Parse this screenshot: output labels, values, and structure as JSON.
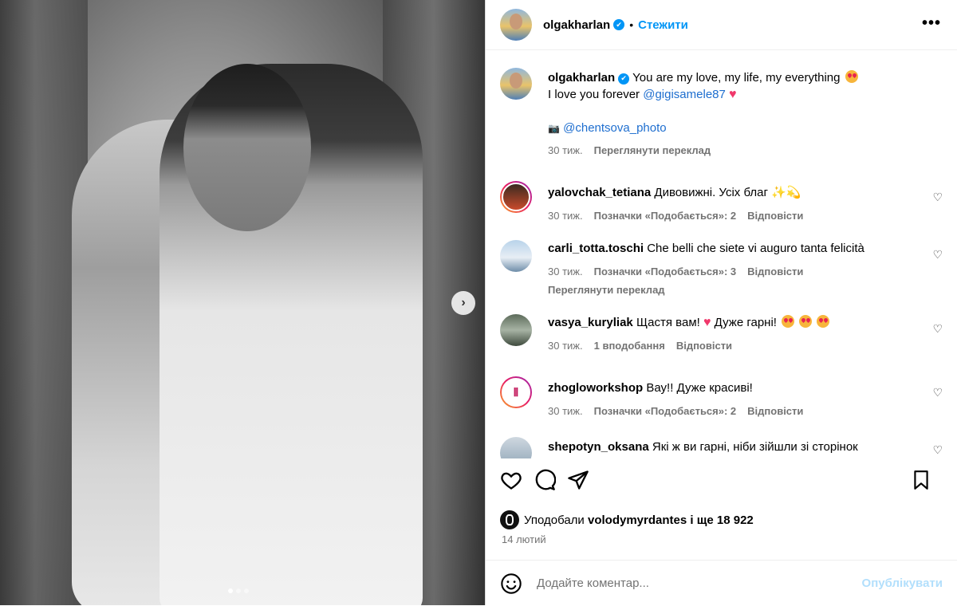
{
  "post": {
    "owner": "olgakharlan",
    "follow_label": "Стежити",
    "separator": "•",
    "more_label": "•••",
    "caption_line1": "You are my love, my life, my everything",
    "caption_line2_prefix": "I love you forever",
    "caption_mention": "@gigisamele87",
    "photo_credit_icon": "📷",
    "photo_credit": "@chentsova_photo",
    "caption_time": "30 тиж.",
    "translate_label": "Переглянути переклад"
  },
  "comments": [
    {
      "user": "yalovchak_tetiana",
      "text": "Дивовижні. Усіх благ",
      "time": "30 тиж.",
      "likes": "Позначки «Подобається»: 2",
      "reply": "Відповісти"
    },
    {
      "user": "carli_totta.toschi",
      "text": "Che belli che siete vi auguro tanta felicità",
      "time": "30 тиж.",
      "likes": "Позначки «Подобається»: 3",
      "reply": "Відповісти",
      "translate": "Переглянути переклад"
    },
    {
      "user": "vasya_kuryliak",
      "text_a": "Щастя вам!",
      "text_b": "Дуже гарні!",
      "time": "30 тиж.",
      "likes": "1 вподобання",
      "reply": "Відповісти"
    },
    {
      "user": "zhogloworkshop",
      "text": "Вау!! Дуже красиві!",
      "time": "30 тиж.",
      "likes": "Позначки «Подобається»: 2",
      "reply": "Відповісти"
    },
    {
      "user": "shepotyn_oksana",
      "text": "Які ж ви гарні, ніби зійшли зі сторінок"
    }
  ],
  "likes_summary": {
    "prefix": "Уподобали",
    "user": "volodymyrdantes",
    "suffix": "і ще 18 922"
  },
  "date": "14 лютий",
  "comment_box": {
    "placeholder": "Додайте коментар...",
    "publish_label": "Опублікувати"
  },
  "icons": {
    "verified": "verified-badge-icon",
    "heart": "heart-icon",
    "comment": "comment-icon",
    "share": "share-icon",
    "save": "bookmark-icon",
    "emoji": "emoji-icon",
    "next": "chevron-right-icon"
  },
  "colors": {
    "accent": "#0095f6",
    "muted": "#737373",
    "mention": "#1e6ecf",
    "publish_disabled": "#b2dffc"
  },
  "carousel": {
    "current": 1,
    "total": 3
  }
}
